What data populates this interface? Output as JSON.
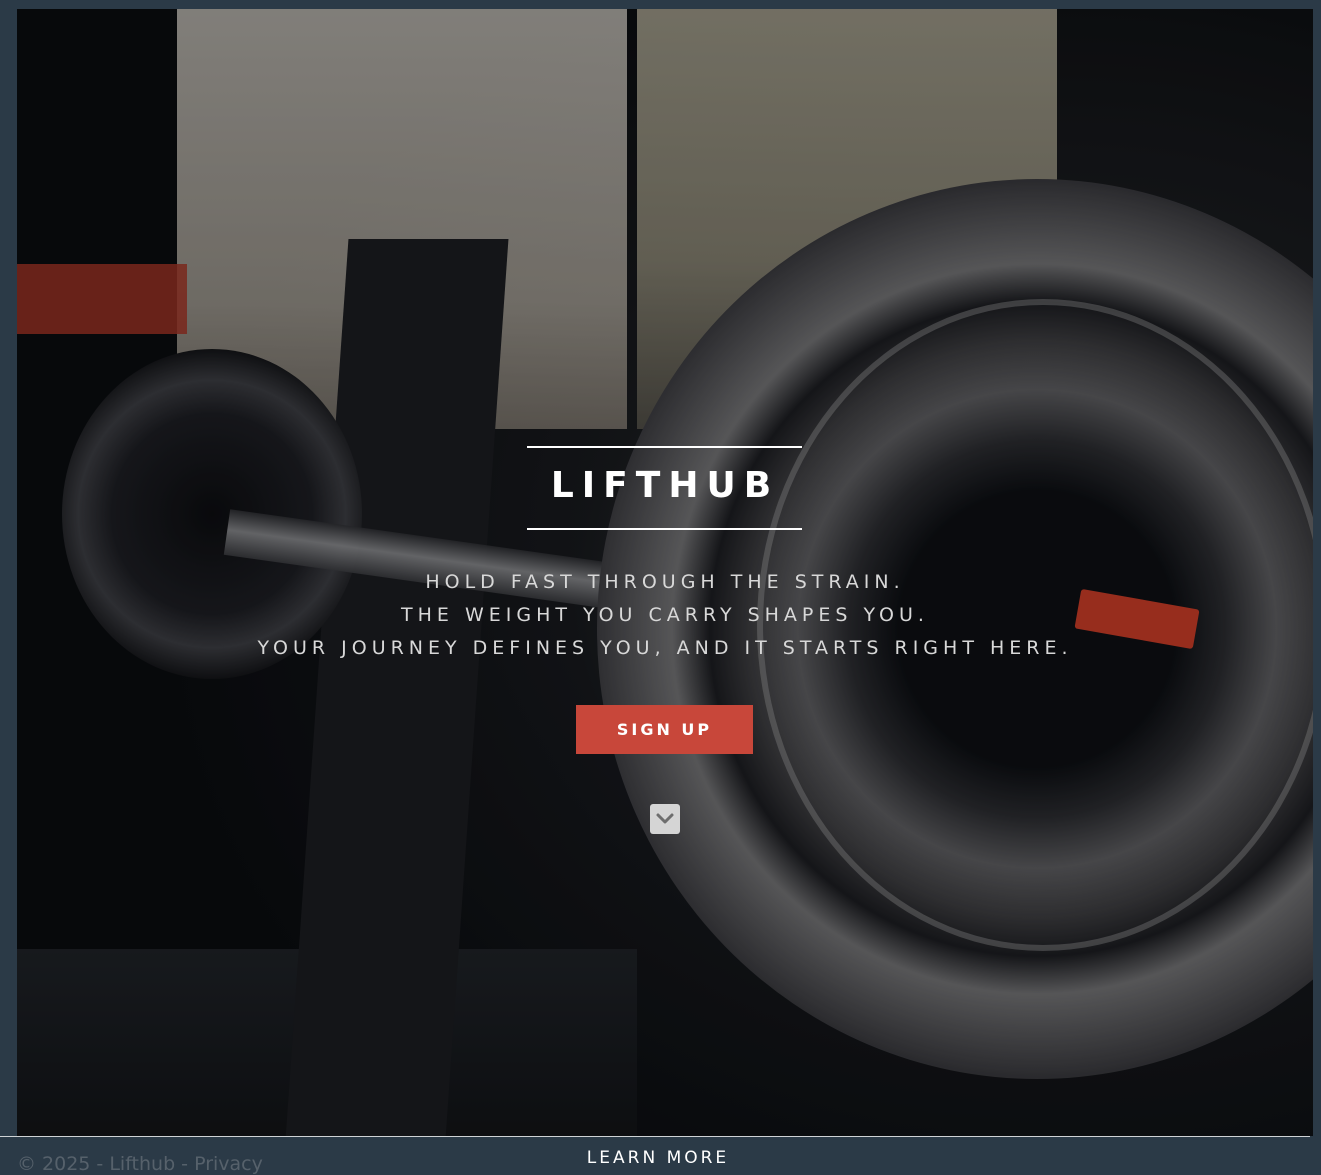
{
  "hero": {
    "brand": "LIFTHUB",
    "tagline_lines": [
      "HOLD FAST THROUGH THE STRAIN.",
      "THE WEIGHT YOU CARRY SHAPES YOU.",
      "YOUR JOURNEY DEFINES YOU, AND IT STARTS RIGHT HERE."
    ],
    "cta_label": "SIGN UP",
    "scroll_icon": "chevron-down-icon",
    "background_image": "barbell-weight-plates-photo"
  },
  "footer": {
    "copyright": "© 2025 - Lifthub - Privacy",
    "learn_more": "LEARN MORE"
  },
  "colors": {
    "page_background": "#2b3a47",
    "accent": "#c8473a",
    "text_primary": "#ffffff",
    "text_muted": "#d8d8d8",
    "footer_text": "#56616b"
  }
}
